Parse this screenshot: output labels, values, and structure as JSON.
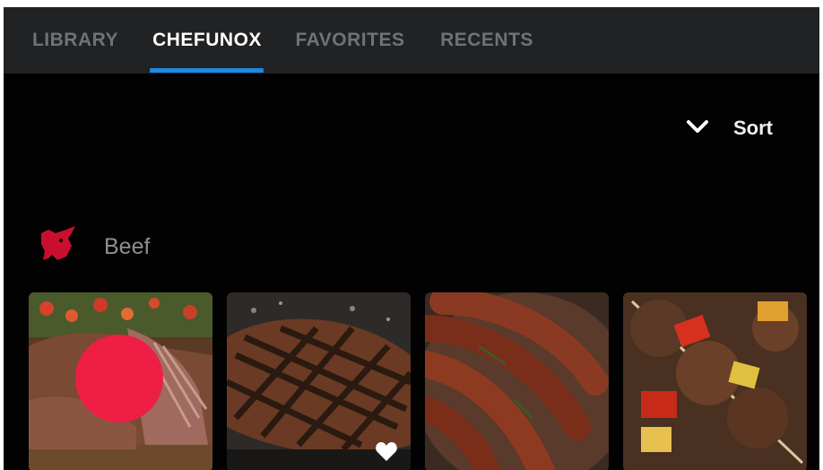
{
  "tabs": [
    {
      "label": "LIBRARY",
      "active": false
    },
    {
      "label": "CHEFUNOX",
      "active": true
    },
    {
      "label": "FAVORITES",
      "active": false
    },
    {
      "label": "RECENTS",
      "active": false
    }
  ],
  "sort": {
    "label": "Sort",
    "icon": "chevron-down-icon"
  },
  "section": {
    "title": "Beef",
    "icon": "cow-head-icon",
    "icon_color": "#c8102e"
  },
  "cards": [
    {
      "image": "sliced-steak-photo"
    },
    {
      "image": "grilled-steak-photo",
      "favorite_icon": "heart-icon"
    },
    {
      "image": "sausages-photo"
    },
    {
      "image": "beef-skewers-photo"
    }
  ],
  "colors": {
    "accent": "#1e88e5",
    "fab": "#ee1e45",
    "tabbar_bg": "#202224",
    "background": "#020202"
  }
}
